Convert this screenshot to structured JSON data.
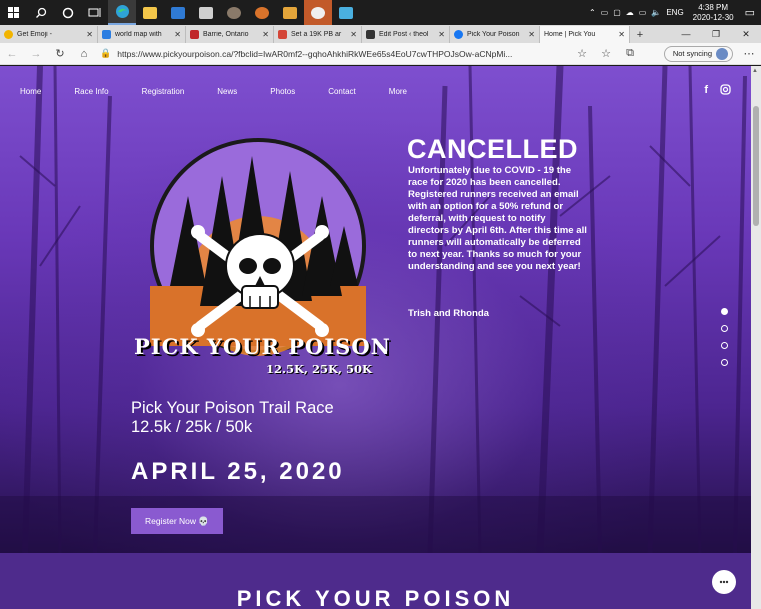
{
  "taskbar": {
    "clock_time": "4:38 PM",
    "clock_date": "2020-12-30",
    "language": "ENG"
  },
  "browser": {
    "tabs": [
      {
        "label": "Get Emoji -",
        "color": "#f2b400"
      },
      {
        "label": "world map with",
        "color": "#2b7de1"
      },
      {
        "label": "Barrie, Ontario",
        "color": "#c0262a"
      },
      {
        "label": "Set a 19K PB ar",
        "color": "#d44638"
      },
      {
        "label": "Edit Post ‹ theol",
        "color": "#333333"
      },
      {
        "label": "Pick Your Poison",
        "color": "#1877f2"
      },
      {
        "label": "Home | Pick You",
        "color": "#ffffff"
      }
    ],
    "url": "https://www.pickyourpoison.ca/?fbclid=IwAR0mf2--gqhoAhkhiRkWEe65s4EoU7cwTHPOJsOw-aCNpMi...",
    "sync_label": "Not syncing"
  },
  "site": {
    "nav": [
      "Home",
      "Race Info",
      "Registration",
      "News",
      "Photos",
      "Contact",
      "More"
    ],
    "cancel_title": "CANCELLED",
    "cancel_body": "Unfortunately due to COVID - 19 the race for 2020 has been cancelled. Registered runners received an email with an option for a 50% refund or deferral, with request to notify directors by April 6th. After this time all runners will automatically be deferred to next year. Thanks so much for your understanding and see you next year!",
    "signoff": "Trish and Rhonda",
    "logo_title": "PICK YOUR POISON",
    "logo_sub": "12.5K, 25K, 50K",
    "race_name": "Pick Your Poison Trail Race",
    "race_distances": "12.5k / 25k / 50k",
    "race_date": "APRIL 25, 2020",
    "register_label": "Register Now 💀",
    "section2_title": "PICK YOUR POISON"
  }
}
